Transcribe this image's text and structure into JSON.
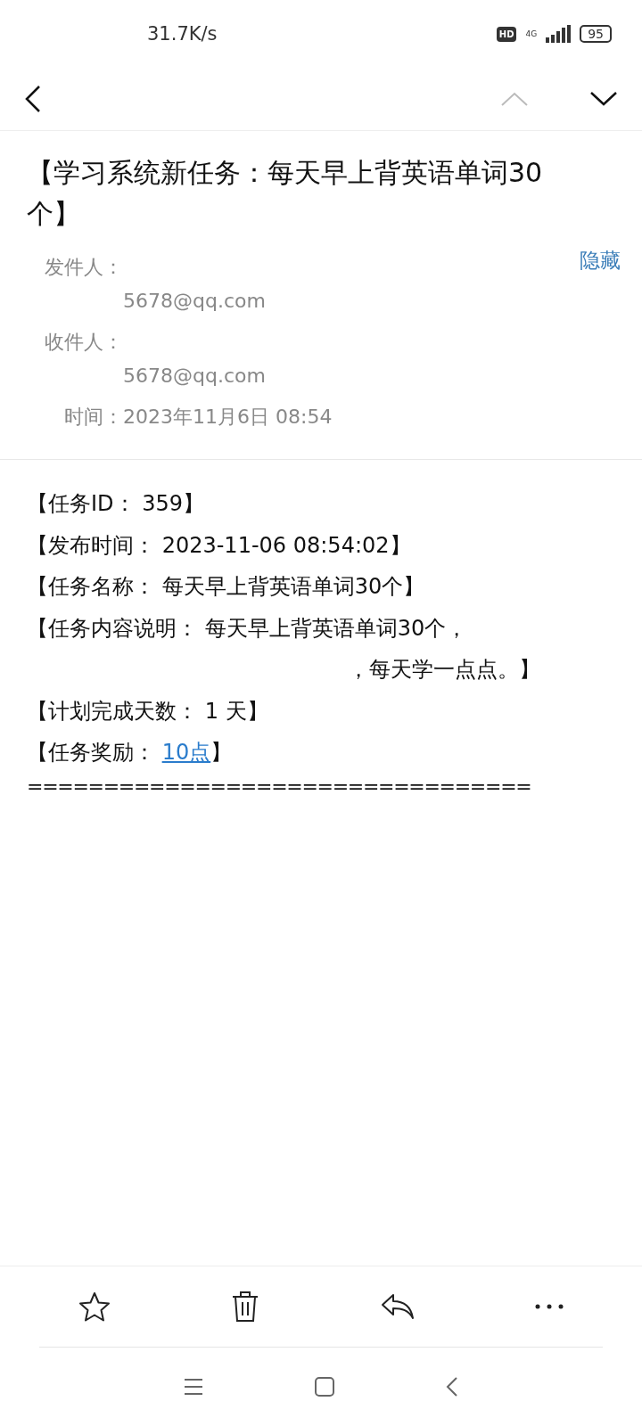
{
  "status_bar": {
    "speed": "31.7K/s",
    "network": "4G",
    "hd": "HD",
    "battery": "95"
  },
  "subject": "【学习系统新任务：每天早上背英语单词30个】",
  "meta": {
    "hide_link": "隐藏",
    "fields": [
      {
        "label": "发件人：",
        "value": "5678@qq.com"
      },
      {
        "label": "收件人：",
        "value": "5678@qq.com"
      },
      {
        "label": "时间：",
        "value": "2023年11月6日 08:54"
      }
    ]
  },
  "body": {
    "lines": [
      {
        "text": "【任务ID： 359】"
      },
      {
        "text": "【发布时间： 2023-11-06 08:54:02】"
      },
      {
        "text": "【任务名称： 每天早上背英语单词30个】"
      },
      {
        "text": "【任务内容说明： 每天早上背英语单词30个，",
        "continued": "，每天学一点点。】"
      },
      {
        "text": "【计划完成天数： 1 天】"
      },
      {
        "text": "【任务奖励： ",
        "link": "10点",
        "after": "】"
      }
    ],
    "separator": "================================="
  }
}
